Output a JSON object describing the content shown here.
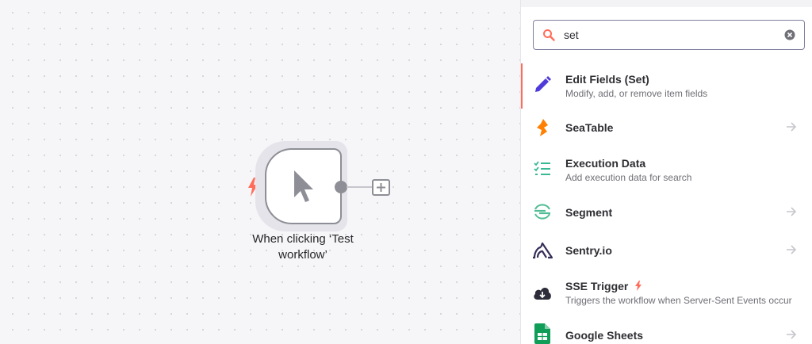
{
  "canvas": {
    "node_label": "When clicking ‘Test workflow’",
    "trigger_color": "#ff6d5a"
  },
  "panel": {
    "search": {
      "value": "set",
      "icon": "search-icon",
      "clear_icon": "clear-icon"
    },
    "items": [
      {
        "name": "Edit Fields (Set)",
        "desc": "Modify, add, or remove item fields",
        "icon": "pencil-icon",
        "selected": true
      },
      {
        "name": "SeaTable",
        "desc": "",
        "icon": "seatable-icon",
        "has_arrow": true
      },
      {
        "name": "Execution Data",
        "desc": "Add execution data for search",
        "icon": "checklist-icon"
      },
      {
        "name": "Segment",
        "desc": "",
        "icon": "segment-icon",
        "has_arrow": true
      },
      {
        "name": "Sentry.io",
        "desc": "",
        "icon": "sentry-icon",
        "has_arrow": true
      },
      {
        "name": "SSE Trigger",
        "desc": "Triggers the workflow when Server-Sent Events occur",
        "icon": "cloud-download-icon",
        "trigger": true
      },
      {
        "name": "Google Sheets",
        "desc": "",
        "icon": "google-sheets-icon",
        "has_arrow": true
      }
    ]
  },
  "colors": {
    "accent": "#ff6d5a",
    "pencil": "#4f3bd9",
    "seatable": "#ff8000",
    "execution": "#3ab795",
    "segment": "#52bd94",
    "sentry": "#362d59",
    "sse": "#2c2c3a",
    "sheets": "#0f9d58"
  }
}
